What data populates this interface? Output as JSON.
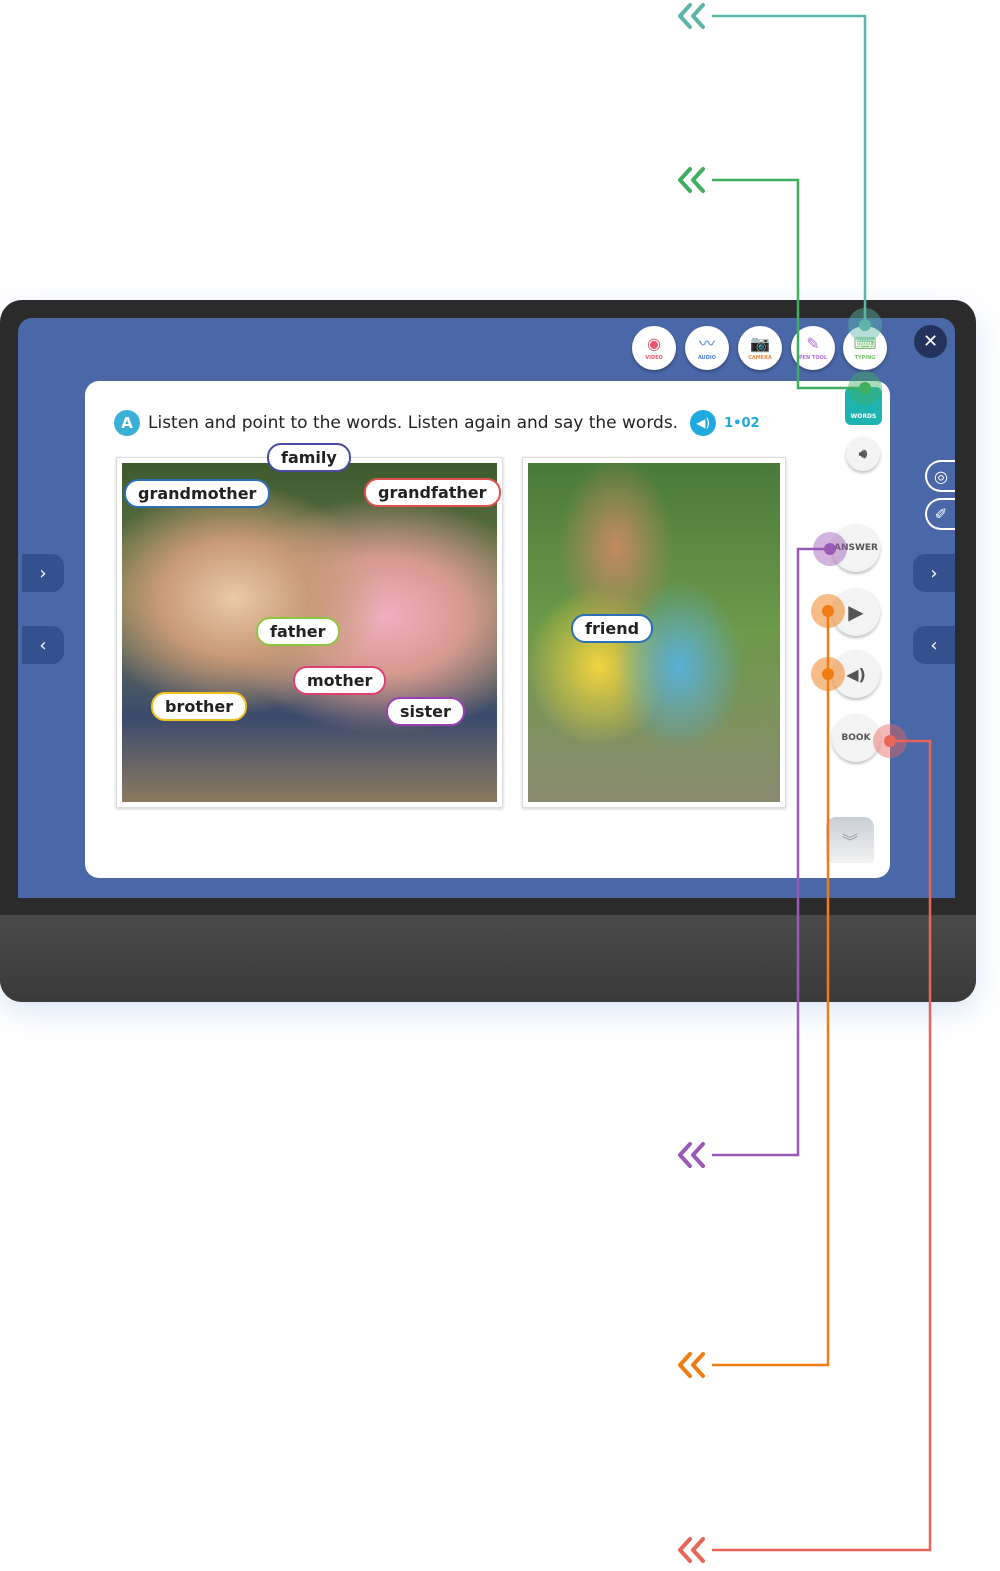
{
  "toolbar": {
    "items": [
      {
        "label": "VIDEO",
        "icon": "record-icon",
        "color": "#e8566c"
      },
      {
        "label": "AUDIO",
        "icon": "waveform-icon",
        "color": "#4a7fd6"
      },
      {
        "label": "CAMERA",
        "icon": "camera-icon",
        "color": "#f08a3c"
      },
      {
        "label": "PEN TOOL",
        "icon": "pencil-icon",
        "color": "#b36ee0"
      },
      {
        "label": "TYPING",
        "icon": "keyboard-icon",
        "color": "#7ac070"
      }
    ]
  },
  "close_icon": "✕",
  "words_button": {
    "label": "WORDS"
  },
  "instruction": {
    "badge": "A",
    "text": "Listen and point to the words. Listen again and say the words.",
    "track": "1•02"
  },
  "tags": {
    "family": "family",
    "grandmother": "grandmother",
    "grandfather": "grandfather",
    "father": "father",
    "mother": "mother",
    "brother": "brother",
    "sister": "sister",
    "friend": "friend"
  },
  "side_buttons": {
    "answer": "ANSWER",
    "book": "BOOK"
  },
  "colors": {
    "screen": "#4a67a8",
    "teal": "#5bb5a8",
    "green": "#3fae5f",
    "purple": "#9b59b6",
    "orange": "#f07c14",
    "red": "#e8655a"
  }
}
